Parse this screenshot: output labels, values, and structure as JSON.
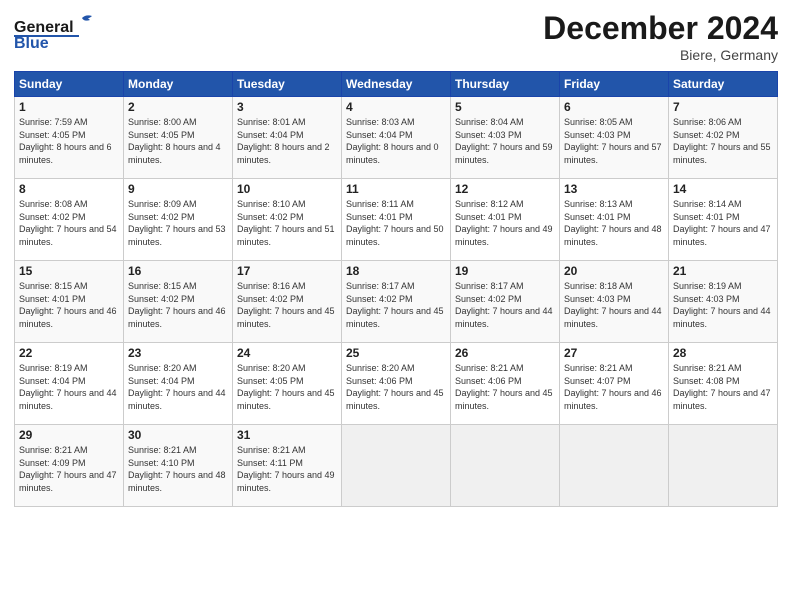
{
  "logo": {
    "line1": "General",
    "line2": "Blue"
  },
  "title": "December 2024",
  "location": "Biere, Germany",
  "days_of_week": [
    "Sunday",
    "Monday",
    "Tuesday",
    "Wednesday",
    "Thursday",
    "Friday",
    "Saturday"
  ],
  "weeks": [
    [
      {
        "day": "1",
        "sunrise": "Sunrise: 7:59 AM",
        "sunset": "Sunset: 4:05 PM",
        "daylight": "Daylight: 8 hours and 6 minutes."
      },
      {
        "day": "2",
        "sunrise": "Sunrise: 8:00 AM",
        "sunset": "Sunset: 4:05 PM",
        "daylight": "Daylight: 8 hours and 4 minutes."
      },
      {
        "day": "3",
        "sunrise": "Sunrise: 8:01 AM",
        "sunset": "Sunset: 4:04 PM",
        "daylight": "Daylight: 8 hours and 2 minutes."
      },
      {
        "day": "4",
        "sunrise": "Sunrise: 8:03 AM",
        "sunset": "Sunset: 4:04 PM",
        "daylight": "Daylight: 8 hours and 0 minutes."
      },
      {
        "day": "5",
        "sunrise": "Sunrise: 8:04 AM",
        "sunset": "Sunset: 4:03 PM",
        "daylight": "Daylight: 7 hours and 59 minutes."
      },
      {
        "day": "6",
        "sunrise": "Sunrise: 8:05 AM",
        "sunset": "Sunset: 4:03 PM",
        "daylight": "Daylight: 7 hours and 57 minutes."
      },
      {
        "day": "7",
        "sunrise": "Sunrise: 8:06 AM",
        "sunset": "Sunset: 4:02 PM",
        "daylight": "Daylight: 7 hours and 55 minutes."
      }
    ],
    [
      {
        "day": "8",
        "sunrise": "Sunrise: 8:08 AM",
        "sunset": "Sunset: 4:02 PM",
        "daylight": "Daylight: 7 hours and 54 minutes."
      },
      {
        "day": "9",
        "sunrise": "Sunrise: 8:09 AM",
        "sunset": "Sunset: 4:02 PM",
        "daylight": "Daylight: 7 hours and 53 minutes."
      },
      {
        "day": "10",
        "sunrise": "Sunrise: 8:10 AM",
        "sunset": "Sunset: 4:02 PM",
        "daylight": "Daylight: 7 hours and 51 minutes."
      },
      {
        "day": "11",
        "sunrise": "Sunrise: 8:11 AM",
        "sunset": "Sunset: 4:01 PM",
        "daylight": "Daylight: 7 hours and 50 minutes."
      },
      {
        "day": "12",
        "sunrise": "Sunrise: 8:12 AM",
        "sunset": "Sunset: 4:01 PM",
        "daylight": "Daylight: 7 hours and 49 minutes."
      },
      {
        "day": "13",
        "sunrise": "Sunrise: 8:13 AM",
        "sunset": "Sunset: 4:01 PM",
        "daylight": "Daylight: 7 hours and 48 minutes."
      },
      {
        "day": "14",
        "sunrise": "Sunrise: 8:14 AM",
        "sunset": "Sunset: 4:01 PM",
        "daylight": "Daylight: 7 hours and 47 minutes."
      }
    ],
    [
      {
        "day": "15",
        "sunrise": "Sunrise: 8:15 AM",
        "sunset": "Sunset: 4:01 PM",
        "daylight": "Daylight: 7 hours and 46 minutes."
      },
      {
        "day": "16",
        "sunrise": "Sunrise: 8:15 AM",
        "sunset": "Sunset: 4:02 PM",
        "daylight": "Daylight: 7 hours and 46 minutes."
      },
      {
        "day": "17",
        "sunrise": "Sunrise: 8:16 AM",
        "sunset": "Sunset: 4:02 PM",
        "daylight": "Daylight: 7 hours and 45 minutes."
      },
      {
        "day": "18",
        "sunrise": "Sunrise: 8:17 AM",
        "sunset": "Sunset: 4:02 PM",
        "daylight": "Daylight: 7 hours and 45 minutes."
      },
      {
        "day": "19",
        "sunrise": "Sunrise: 8:17 AM",
        "sunset": "Sunset: 4:02 PM",
        "daylight": "Daylight: 7 hours and 44 minutes."
      },
      {
        "day": "20",
        "sunrise": "Sunrise: 8:18 AM",
        "sunset": "Sunset: 4:03 PM",
        "daylight": "Daylight: 7 hours and 44 minutes."
      },
      {
        "day": "21",
        "sunrise": "Sunrise: 8:19 AM",
        "sunset": "Sunset: 4:03 PM",
        "daylight": "Daylight: 7 hours and 44 minutes."
      }
    ],
    [
      {
        "day": "22",
        "sunrise": "Sunrise: 8:19 AM",
        "sunset": "Sunset: 4:04 PM",
        "daylight": "Daylight: 7 hours and 44 minutes."
      },
      {
        "day": "23",
        "sunrise": "Sunrise: 8:20 AM",
        "sunset": "Sunset: 4:04 PM",
        "daylight": "Daylight: 7 hours and 44 minutes."
      },
      {
        "day": "24",
        "sunrise": "Sunrise: 8:20 AM",
        "sunset": "Sunset: 4:05 PM",
        "daylight": "Daylight: 7 hours and 45 minutes."
      },
      {
        "day": "25",
        "sunrise": "Sunrise: 8:20 AM",
        "sunset": "Sunset: 4:06 PM",
        "daylight": "Daylight: 7 hours and 45 minutes."
      },
      {
        "day": "26",
        "sunrise": "Sunrise: 8:21 AM",
        "sunset": "Sunset: 4:06 PM",
        "daylight": "Daylight: 7 hours and 45 minutes."
      },
      {
        "day": "27",
        "sunrise": "Sunrise: 8:21 AM",
        "sunset": "Sunset: 4:07 PM",
        "daylight": "Daylight: 7 hours and 46 minutes."
      },
      {
        "day": "28",
        "sunrise": "Sunrise: 8:21 AM",
        "sunset": "Sunset: 4:08 PM",
        "daylight": "Daylight: 7 hours and 47 minutes."
      }
    ],
    [
      {
        "day": "29",
        "sunrise": "Sunrise: 8:21 AM",
        "sunset": "Sunset: 4:09 PM",
        "daylight": "Daylight: 7 hours and 47 minutes."
      },
      {
        "day": "30",
        "sunrise": "Sunrise: 8:21 AM",
        "sunset": "Sunset: 4:10 PM",
        "daylight": "Daylight: 7 hours and 48 minutes."
      },
      {
        "day": "31",
        "sunrise": "Sunrise: 8:21 AM",
        "sunset": "Sunset: 4:11 PM",
        "daylight": "Daylight: 7 hours and 49 minutes."
      },
      null,
      null,
      null,
      null
    ]
  ]
}
